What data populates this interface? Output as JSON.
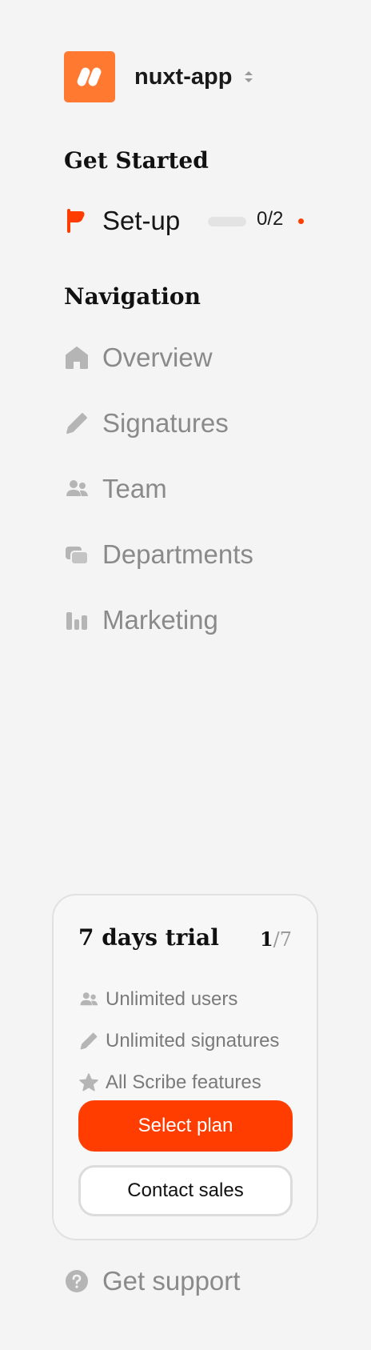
{
  "workspace": {
    "name": "nuxt-app"
  },
  "get_started": {
    "title": "Get Started",
    "setup": {
      "label": "Set-up",
      "progress_text": "0/2",
      "progress": 0
    }
  },
  "navigation": {
    "title": "Navigation",
    "items": [
      {
        "label": "Overview",
        "icon": "home-icon"
      },
      {
        "label": "Signatures",
        "icon": "pen-icon"
      },
      {
        "label": "Team",
        "icon": "users-icon"
      },
      {
        "label": "Departments",
        "icon": "folders-icon"
      },
      {
        "label": "Marketing",
        "icon": "bar-chart-icon"
      }
    ]
  },
  "trial": {
    "title": "7 days trial",
    "current_day": "1",
    "total_days": "/7",
    "features": [
      {
        "label": "Unlimited users",
        "icon": "users-icon"
      },
      {
        "label": "Unlimited signatures",
        "icon": "pen-icon"
      },
      {
        "label": "All Scribe features",
        "icon": "star-icon"
      }
    ],
    "select_plan_label": "Select plan",
    "contact_sales_label": "Contact sales"
  },
  "support": {
    "label": "Get support",
    "icon": "help-circle-icon"
  },
  "colors": {
    "accent": "#ff3d00",
    "logo": "#ff7a30",
    "muted": "#8a8a8a",
    "background": "#f4f4f4"
  }
}
